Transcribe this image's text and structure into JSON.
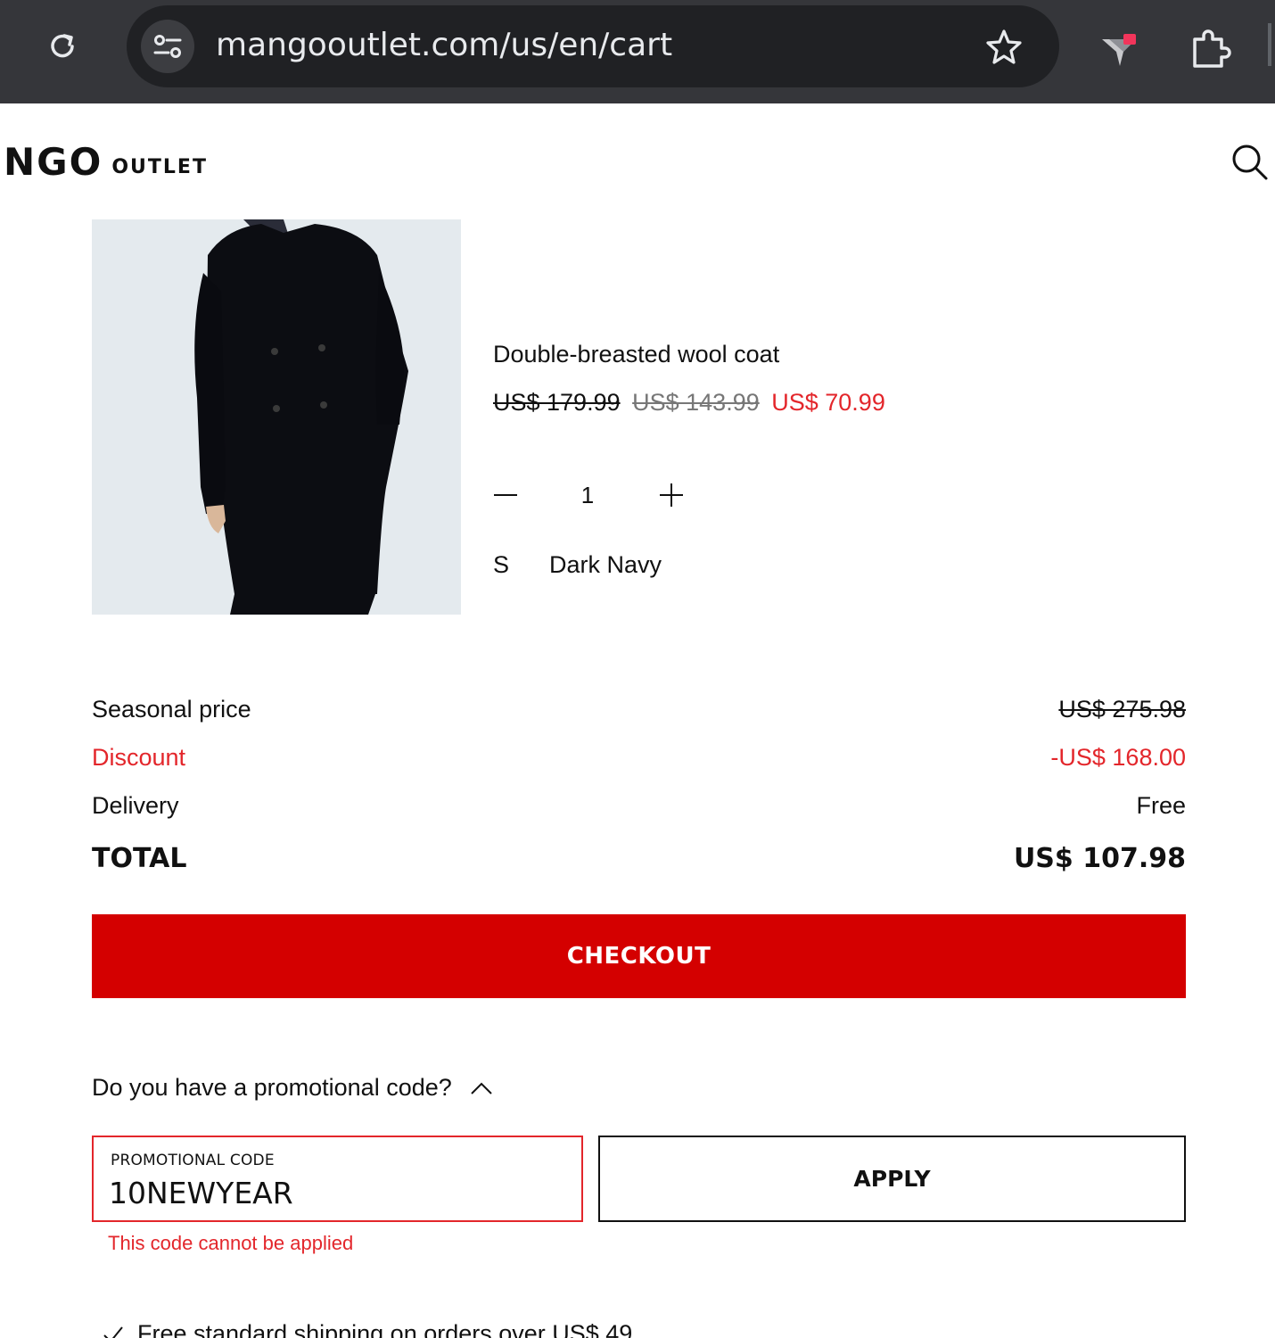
{
  "browser": {
    "url": "mangooutlet.com/us/en/cart"
  },
  "header": {
    "logo_text": "NGO",
    "logo_suffix": "OUTLET"
  },
  "product": {
    "name": "Double-breasted wool coat",
    "price_original": "US$ 179.99",
    "price_previous": "US$ 143.99",
    "price_current": "US$ 70.99",
    "quantity": "1",
    "size": "S",
    "color": "Dark Navy"
  },
  "summary": {
    "seasonal_label": "Seasonal price",
    "seasonal_value": "US$ 275.98",
    "discount_label": "Discount",
    "discount_value": "-US$ 168.00",
    "delivery_label": "Delivery",
    "delivery_value": "Free",
    "total_label": "TOTAL",
    "total_value": "US$ 107.98"
  },
  "checkout_label": "CHECKOUT",
  "promo": {
    "question": "Do you have a promotional code?",
    "field_label": "PROMOTIONAL CODE",
    "field_value": "10NEWYEAR",
    "apply_label": "APPLY",
    "error": "This code cannot be applied"
  },
  "shipping_note": "Free standard shipping on orders over US$ 49",
  "colors": {
    "brand_red": "#d40000",
    "price_red": "#e3262b",
    "chrome_bg": "#35363a"
  }
}
